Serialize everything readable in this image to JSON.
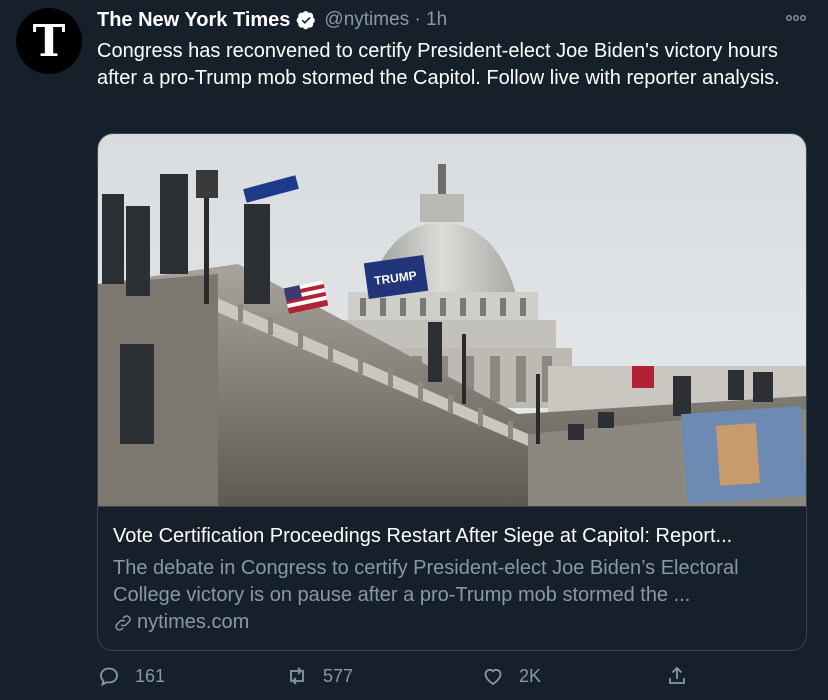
{
  "author": {
    "name": "The New York Times",
    "handle": "@nytimes · 1h",
    "avatar_letter": "T",
    "verified": true
  },
  "tweet": {
    "text": "Congress has reconvened to certify President-elect Joe Biden's victory hours after a pro-Trump mob stormed the Capitol. Follow live with reporter analysis."
  },
  "card": {
    "image": {
      "flag_text": "TRUMP"
    },
    "title": "Vote Certification Proceedings Restart After Siege at Capitol: Report...",
    "description": "The debate in Congress to certify President-elect Joe Biden’s Electoral College victory is on pause after a pro-Trump mob stormed the ...",
    "domain": "nytimes.com"
  },
  "actions": {
    "replies": "161",
    "retweets": "577",
    "likes": "2K"
  },
  "icons": [
    "more-icon",
    "verified-icon",
    "link-icon",
    "reply-icon",
    "retweet-icon",
    "like-icon",
    "share-icon"
  ],
  "colors": {
    "background": "#15202b",
    "secondary_text": "#8899a6",
    "border": "#38444d"
  }
}
